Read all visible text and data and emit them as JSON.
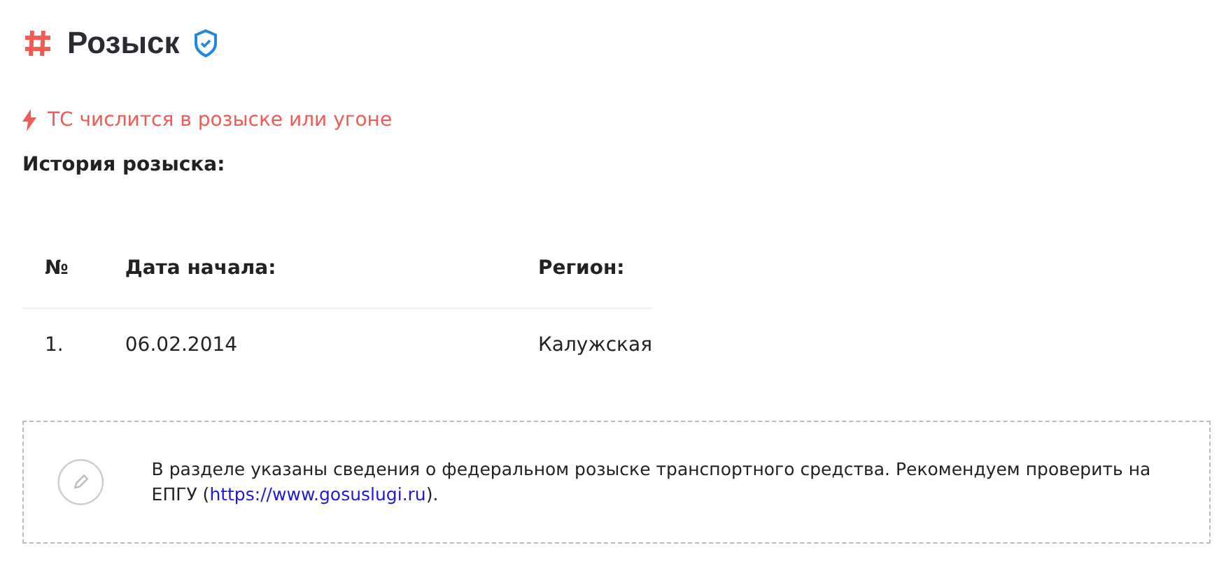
{
  "header": {
    "title": "Розыск"
  },
  "alert": {
    "text": "ТС числится в розыске или угоне"
  },
  "history": {
    "title": "История розыска:",
    "columns": [
      "№",
      "Дата начала:",
      "Регион:"
    ],
    "rows": [
      {
        "cells": [
          "1.",
          "06.02.2014",
          "Калужская"
        ]
      }
    ]
  },
  "note": {
    "text_before": "В разделе указаны сведения о федеральном розыске транспортного средства. Рекомендуем проверить на ЕПГУ (",
    "link": "https://www.gosuslugi.ru",
    "text_after": ")."
  }
}
